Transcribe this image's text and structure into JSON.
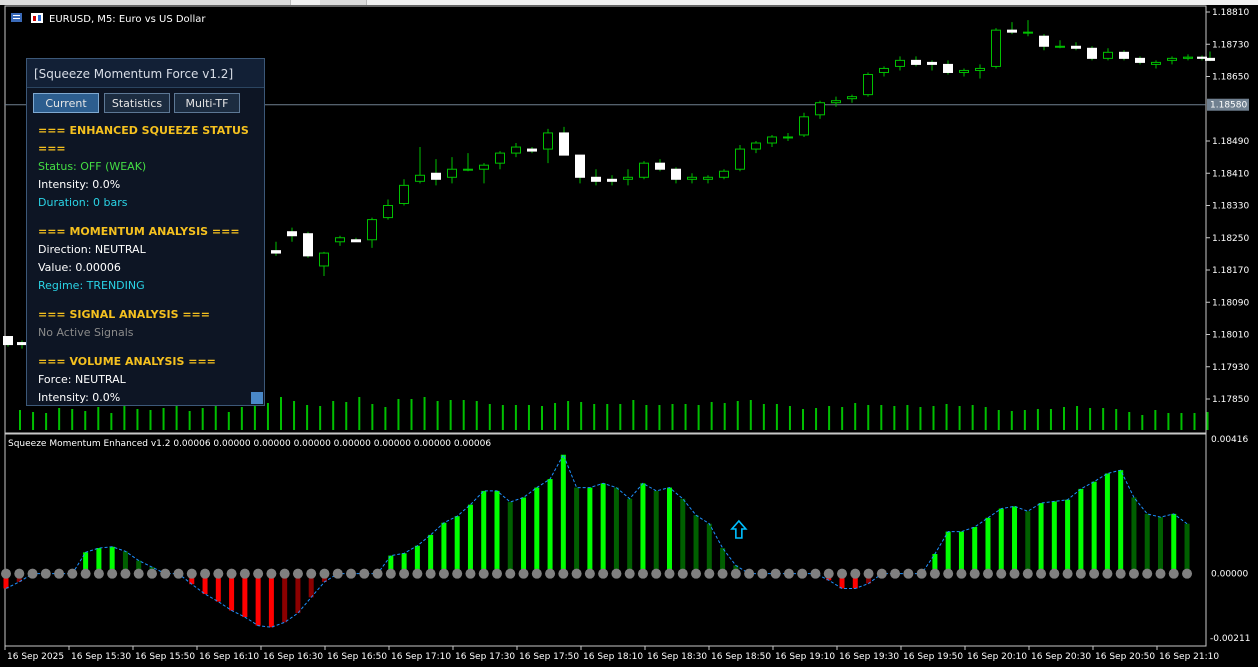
{
  "chart": {
    "symbol_title": "EURUSD, M5:  Euro vs US Dollar",
    "price_labels": [
      "1.18810",
      "1.18730",
      "1.18650",
      "1.18580",
      "1.18490",
      "1.18410",
      "1.18330",
      "1.18250",
      "1.18170",
      "1.18090",
      "1.18010",
      "1.17930",
      "1.17850"
    ],
    "current_price": "1.18580",
    "time_labels": [
      "16 Sep 2025",
      "16 Sep 15:30",
      "16 Sep 15:50",
      "16 Sep 16:10",
      "16 Sep 16:30",
      "16 Sep 16:50",
      "16 Sep 17:10",
      "16 Sep 17:30",
      "16 Sep 17:50",
      "16 Sep 18:10",
      "16 Sep 18:30",
      "16 Sep 18:50",
      "16 Sep 19:10",
      "16 Sep 19:30",
      "16 Sep 19:50",
      "16 Sep 20:10",
      "16 Sep 20:30",
      "16 Sep 20:50",
      "16 Sep 21:10"
    ],
    "candles": [
      [
        1.18005,
        1.18005,
        1.1798,
        1.17985
      ],
      [
        1.1799,
        1.17995,
        1.17975,
        1.17985
      ],
      [
        1.18218,
        1.1824,
        1.18205,
        1.18212
      ],
      [
        1.18265,
        1.18275,
        1.1824,
        1.18255
      ],
      [
        1.1826,
        1.18265,
        1.182,
        1.18205
      ],
      [
        1.1818,
        1.18215,
        1.18155,
        1.18212
      ],
      [
        1.1824,
        1.18255,
        1.1823,
        1.1825
      ],
      [
        1.18245,
        1.1825,
        1.1824,
        1.1824
      ],
      [
        1.18245,
        1.183,
        1.18225,
        1.18295
      ],
      [
        1.183,
        1.18345,
        1.18295,
        1.1833
      ],
      [
        1.18335,
        1.18395,
        1.1833,
        1.1838
      ],
      [
        1.1839,
        1.18475,
        1.18385,
        1.18405
      ],
      [
        1.1841,
        1.18445,
        1.1838,
        1.18395
      ],
      [
        1.184,
        1.1845,
        1.18385,
        1.1842
      ],
      [
        1.1842,
        1.1846,
        1.18415,
        1.1842
      ],
      [
        1.1842,
        1.18435,
        1.18385,
        1.1843
      ],
      [
        1.18435,
        1.18465,
        1.1842,
        1.1846
      ],
      [
        1.1846,
        1.18485,
        1.1845,
        1.18475
      ],
      [
        1.1847,
        1.18475,
        1.1846,
        1.18465
      ],
      [
        1.1847,
        1.1852,
        1.18435,
        1.1851
      ],
      [
        1.1851,
        1.18525,
        1.18455,
        1.18455
      ],
      [
        1.18455,
        1.1842,
        1.18385,
        1.184
      ],
      [
        1.184,
        1.1842,
        1.1838,
        1.1839
      ],
      [
        1.18395,
        1.18405,
        1.1838,
        1.1839
      ],
      [
        1.18395,
        1.1842,
        1.1838,
        1.184
      ],
      [
        1.184,
        1.1844,
        1.18395,
        1.18435
      ],
      [
        1.18435,
        1.18445,
        1.18415,
        1.1842
      ],
      [
        1.1842,
        1.18425,
        1.18385,
        1.18395
      ],
      [
        1.18395,
        1.1841,
        1.18385,
        1.184
      ],
      [
        1.18395,
        1.18405,
        1.18385,
        1.184
      ],
      [
        1.184,
        1.1842,
        1.18395,
        1.18415
      ],
      [
        1.1842,
        1.1848,
        1.18415,
        1.1847
      ],
      [
        1.1847,
        1.1849,
        1.1846,
        1.18485
      ],
      [
        1.18485,
        1.18505,
        1.18475,
        1.185
      ],
      [
        1.185,
        1.1851,
        1.1849,
        1.185
      ],
      [
        1.18505,
        1.1856,
        1.185,
        1.1855
      ],
      [
        1.18555,
        1.1859,
        1.18545,
        1.18585
      ],
      [
        1.18585,
        1.186,
        1.18575,
        1.1859
      ],
      [
        1.18595,
        1.18605,
        1.18585,
        1.186
      ],
      [
        1.18605,
        1.1866,
        1.186,
        1.18655
      ],
      [
        1.1866,
        1.18675,
        1.1865,
        1.1867
      ],
      [
        1.18675,
        1.187,
        1.18665,
        1.1869
      ],
      [
        1.1869,
        1.187,
        1.18675,
        1.1868
      ],
      [
        1.18685,
        1.1869,
        1.18665,
        1.1868
      ],
      [
        1.1868,
        1.1869,
        1.18655,
        1.1866
      ],
      [
        1.1866,
        1.1867,
        1.1865,
        1.18665
      ],
      [
        1.18665,
        1.1868,
        1.18645,
        1.1867
      ],
      [
        1.18675,
        1.1877,
        1.1867,
        1.18765
      ],
      [
        1.18765,
        1.18785,
        1.18755,
        1.1876
      ],
      [
        1.1876,
        1.1879,
        1.1875,
        1.1876
      ],
      [
        1.1875,
        1.18755,
        1.18715,
        1.18725
      ],
      [
        1.18725,
        1.1874,
        1.1872,
        1.18725
      ],
      [
        1.18725,
        1.18735,
        1.18715,
        1.1872
      ],
      [
        1.1872,
        1.18725,
        1.1869,
        1.18695
      ],
      [
        1.18695,
        1.1872,
        1.1869,
        1.1871
      ],
      [
        1.1871,
        1.18715,
        1.1869,
        1.18695
      ],
      [
        1.18695,
        1.187,
        1.1868,
        1.18685
      ],
      [
        1.1868,
        1.1869,
        1.1867,
        1.18685
      ],
      [
        1.1869,
        1.187,
        1.1868,
        1.18695
      ],
      [
        1.18695,
        1.18705,
        1.1869,
        1.18698
      ],
      [
        1.18698,
        1.18702,
        1.1869,
        1.18695
      ],
      [
        1.18695,
        1.18712,
        1.18688,
        1.1869
      ]
    ],
    "candle_x": [
      8,
      22,
      276,
      292,
      308,
      324,
      340,
      356,
      372,
      388,
      404,
      420,
      436,
      452,
      468,
      484,
      500,
      516,
      532,
      548,
      564,
      580,
      596,
      612,
      628,
      644,
      660,
      676,
      692,
      708,
      724,
      740,
      756,
      772,
      788,
      804,
      820,
      836,
      852,
      868,
      884,
      900,
      916,
      932,
      948,
      964,
      980,
      996,
      1012,
      1028,
      1044,
      1060,
      1076,
      1092,
      1108,
      1124,
      1140,
      1156,
      1172,
      1188,
      1202,
      1210
    ],
    "volume": [
      20,
      18,
      17,
      22,
      21,
      19,
      23,
      17,
      24,
      21,
      20,
      22,
      26,
      19,
      22,
      25,
      18,
      23,
      24,
      27,
      33,
      29,
      25,
      24,
      29,
      28,
      33,
      26,
      23,
      31,
      31,
      33,
      29,
      30,
      30,
      29,
      26,
      25,
      25,
      25,
      24,
      27,
      29,
      28,
      26,
      26,
      26,
      30,
      25,
      25,
      26,
      26,
      25,
      28,
      27,
      29,
      30,
      26,
      26,
      24,
      21,
      22,
      24,
      23,
      27,
      25,
      25,
      24,
      25,
      23,
      24,
      26,
      24,
      25,
      23,
      20,
      19,
      20,
      21,
      21,
      23,
      24,
      22,
      22,
      21,
      18,
      15,
      20,
      17,
      17,
      17,
      18
    ],
    "histogram": [
      -0.00045,
      -0.00025,
      0,
      0,
      0,
      0,
      0.00065,
      0.00078,
      0.00082,
      0.00068,
      0.0004,
      0.0002,
      0,
      0,
      -0.00032,
      -0.00062,
      -0.00085,
      -0.00112,
      -0.00132,
      -0.00158,
      -0.00163,
      -0.00148,
      -0.0012,
      -0.00072,
      -0.00025,
      0,
      0,
      0,
      0,
      0.00055,
      0.00062,
      0.00085,
      0.00118,
      0.00155,
      0.00175,
      0.0021,
      0.00252,
      0.00252,
      0.00218,
      0.00232,
      0.00262,
      0.00288,
      0.00362,
      0.00262,
      0.00262,
      0.00275,
      0.00262,
      0.00228,
      0.00275,
      0.00252,
      0.00262,
      0.00228,
      0.00178,
      0.00152,
      0.00078,
      0.00025,
      0,
      0,
      0,
      0,
      0,
      0,
      -0.0002,
      -0.00045,
      -0.00045,
      -0.0003,
      0,
      0,
      0,
      0,
      0.0006,
      0.00128,
      0.00128,
      0.00142,
      0.0017,
      0.00198,
      0.00205,
      0.0019,
      0.00215,
      0.0022,
      0.00225,
      0.00258,
      0.0028,
      0.00305,
      0.00315,
      0.00232,
      0.00182,
      0.00172,
      0.00182,
      0.00152
    ],
    "hist_x_start": 6,
    "hist_step": 13.27,
    "signal_arrow_index": 55,
    "indicator_title": "Squeeze Momentum Enhanced v1.2 0.00006 0.00000 0.00000 0.00000 0.00000 0.00000 0.00000 0.00006",
    "ind_top_label": "0.00416",
    "ind_zero_label": "0.00000",
    "ind_bottom_label": "-0.00211",
    "colors": {
      "candle_bull": "#00c000",
      "bright_green": "#00ff00",
      "dark_green": "#006000",
      "bright_red": "#ff0000",
      "dark_red": "#8b0000",
      "dot": "#808080",
      "signal_line": "#1e90ff",
      "arrow": "#00bfff",
      "price_line": "#708090"
    }
  },
  "panel": {
    "title": "[Squeeze Momentum Force v1.2]",
    "tabs": [
      "Current",
      "Statistics",
      "Multi-TF"
    ],
    "sections": [
      {
        "header": "=== ENHANCED SQUEEZE STATUS ===",
        "lines": [
          {
            "text": "Status: OFF (WEAK)",
            "color": "#44dd44"
          },
          {
            "text": "Intensity: 0.0%",
            "color": "#ffffff"
          },
          {
            "text": "Duration: 0 bars",
            "color": "#2ad4e6"
          }
        ]
      },
      {
        "header": "=== MOMENTUM ANALYSIS ===",
        "lines": [
          {
            "text": "Direction: NEUTRAL",
            "color": "#ffffff"
          },
          {
            "text": "Value: 0.00006",
            "color": "#ffffff"
          },
          {
            "text": "Regime: TRENDING",
            "color": "#2ad4e6"
          }
        ]
      },
      {
        "header": "=== SIGNAL ANALYSIS ===",
        "lines": [
          {
            "text": "No Active Signals",
            "color": "#8a8a8a"
          }
        ]
      },
      {
        "header": "=== VOLUME ANALYSIS ===",
        "lines": [
          {
            "text": "Force: NEUTRAL",
            "color": "#ffffff"
          },
          {
            "text": "Intensity: 0.0%",
            "color": "#ffffff"
          }
        ]
      }
    ]
  }
}
